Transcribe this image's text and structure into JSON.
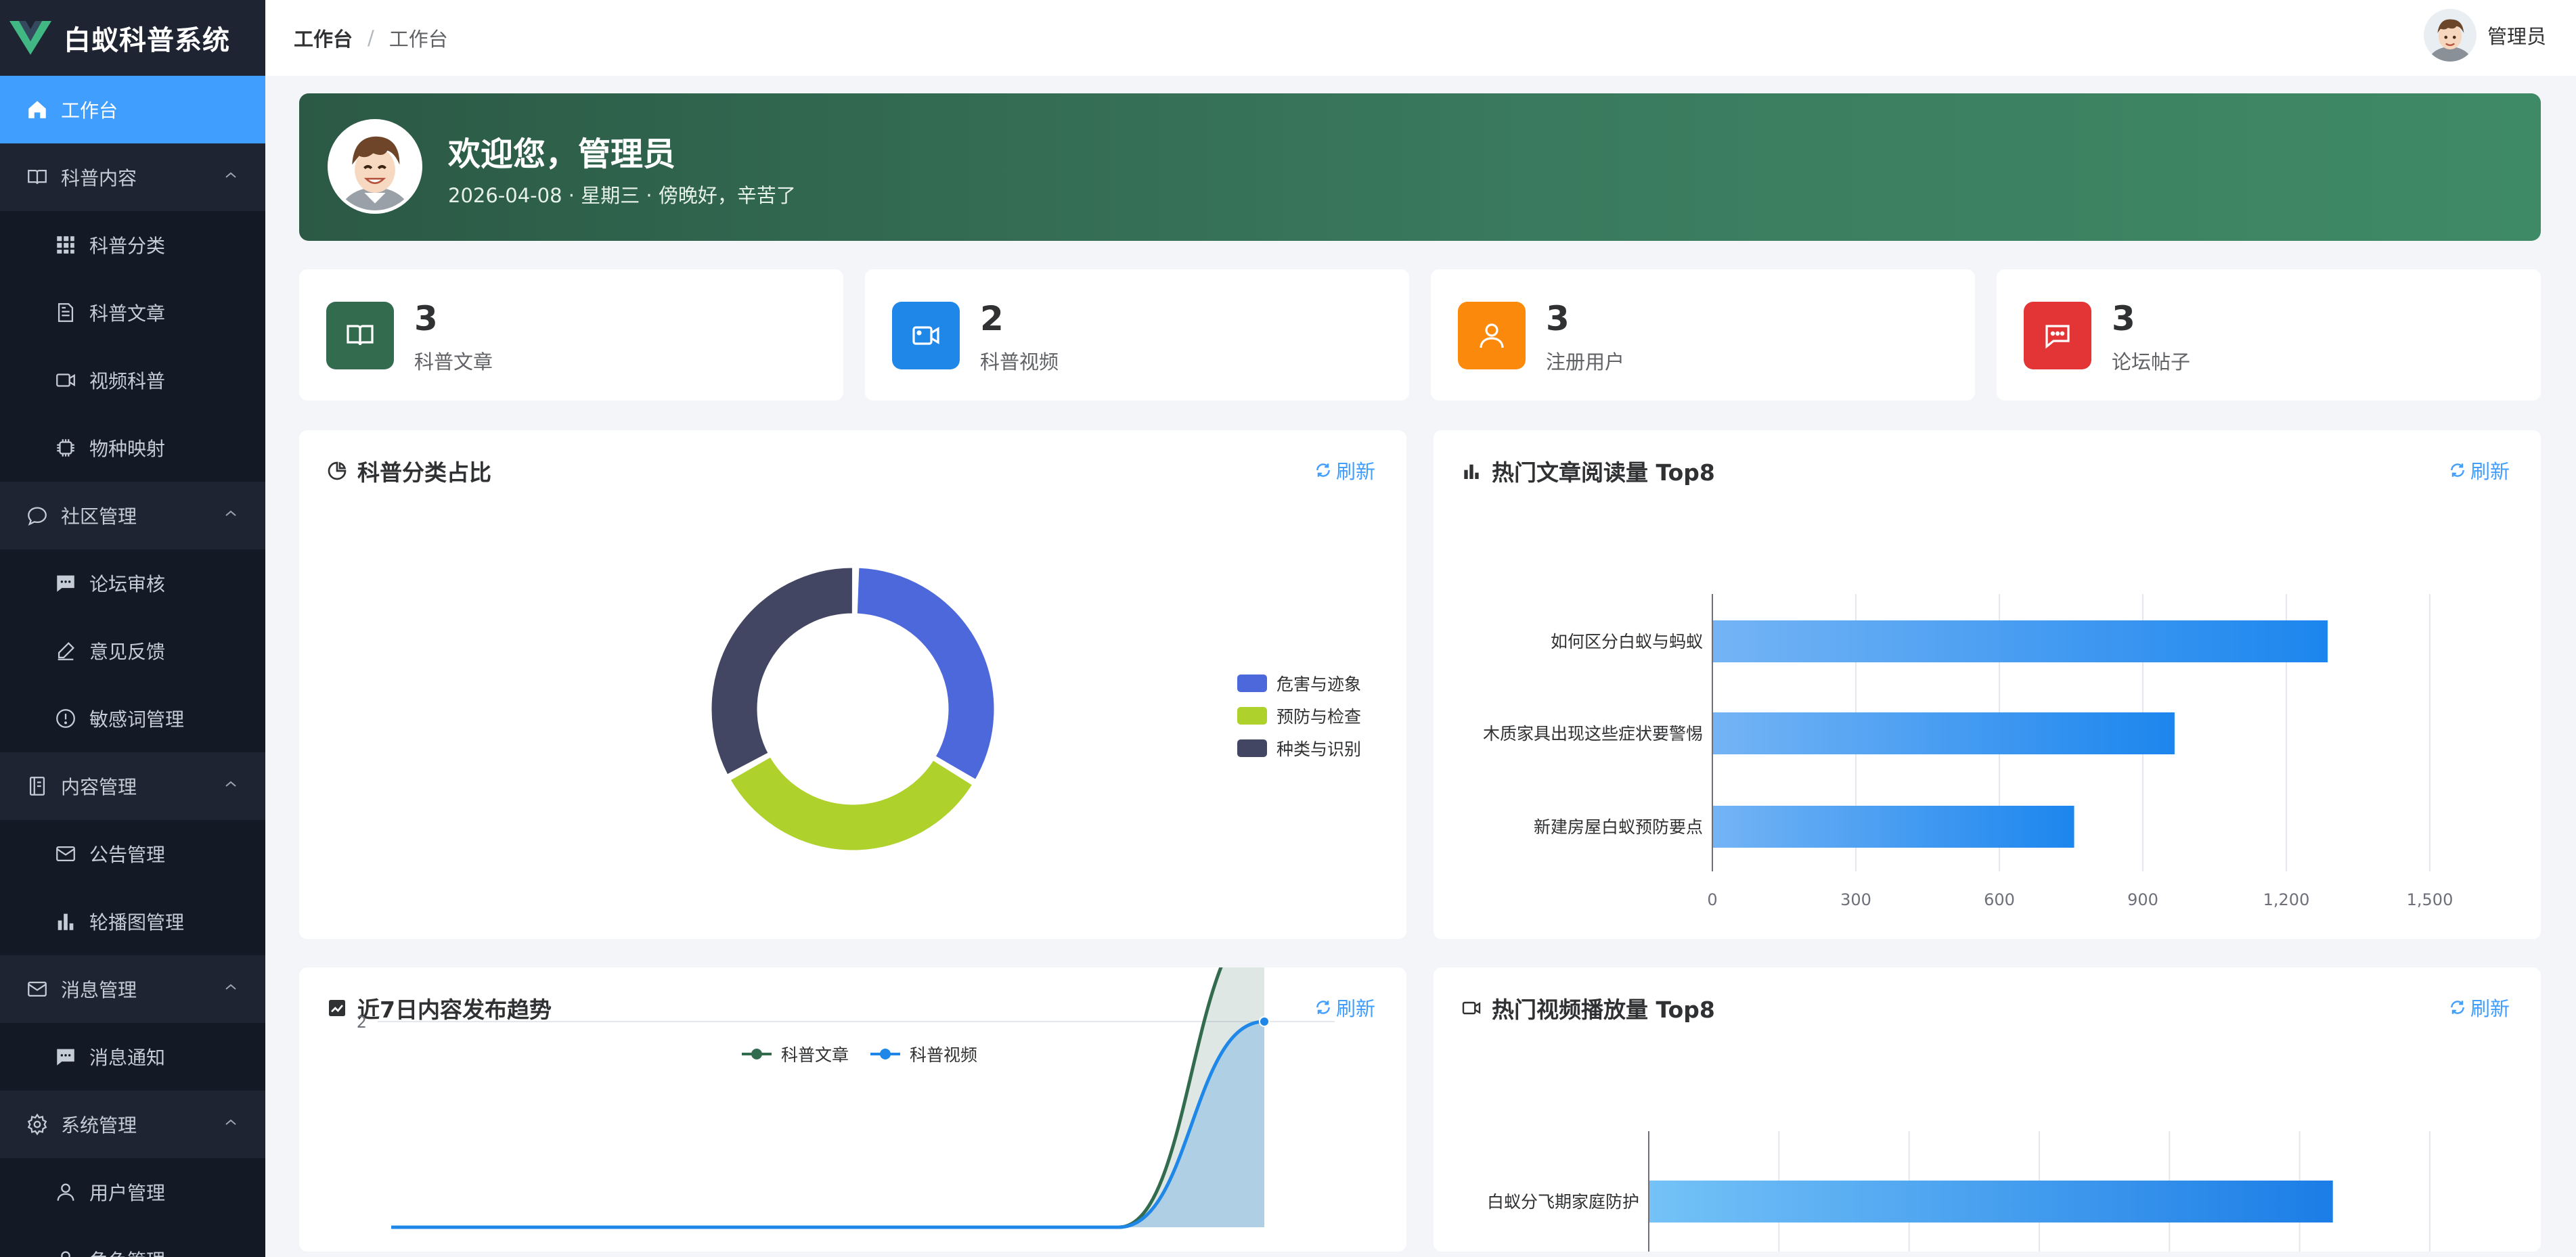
{
  "app": {
    "title": "白蚁科普系统"
  },
  "sidebar": {
    "items": [
      {
        "label": "工作台",
        "icon": "home-icon",
        "level": "parent",
        "active": true
      },
      {
        "label": "科普内容",
        "icon": "book-icon",
        "level": "parent",
        "expanded": true
      },
      {
        "label": "科普分类",
        "icon": "grid-icon",
        "level": "child"
      },
      {
        "label": "科普文章",
        "icon": "document-icon",
        "level": "child"
      },
      {
        "label": "视频科普",
        "icon": "video-icon",
        "level": "child"
      },
      {
        "label": "物种映射",
        "icon": "chip-icon",
        "level": "child"
      },
      {
        "label": "社区管理",
        "icon": "chat-icon",
        "level": "parent",
        "expanded": true
      },
      {
        "label": "论坛审核",
        "icon": "message-icon",
        "level": "child"
      },
      {
        "label": "意见反馈",
        "icon": "edit-icon",
        "level": "child"
      },
      {
        "label": "敏感词管理",
        "icon": "warning-icon",
        "level": "child"
      },
      {
        "label": "内容管理",
        "icon": "notebook-icon",
        "level": "parent",
        "expanded": true
      },
      {
        "label": "公告管理",
        "icon": "mail-icon",
        "level": "child"
      },
      {
        "label": "轮播图管理",
        "icon": "bar-chart-icon",
        "level": "child"
      },
      {
        "label": "消息管理",
        "icon": "mail-icon",
        "level": "parent",
        "expanded": true
      },
      {
        "label": "消息通知",
        "icon": "message-icon",
        "level": "child"
      },
      {
        "label": "系统管理",
        "icon": "gear-icon",
        "level": "parent",
        "expanded": true
      },
      {
        "label": "用户管理",
        "icon": "user-icon",
        "level": "child"
      },
      {
        "label": "角色管理",
        "icon": "user-icon",
        "level": "child"
      }
    ]
  },
  "header": {
    "breadcrumb": [
      "工作台",
      "工作台"
    ],
    "separator": "/",
    "user_name": "管理员"
  },
  "banner": {
    "title": "欢迎您，管理员",
    "subtitle": "2026-04-08 · 星期三 · 傍晚好，辛苦了"
  },
  "stats": [
    {
      "value": "3",
      "label": "科普文章",
      "color": "#336b4f",
      "icon": "book-icon"
    },
    {
      "value": "2",
      "label": "科普视频",
      "color": "#1f87e8",
      "icon": "video-icon"
    },
    {
      "value": "3",
      "label": "注册用户",
      "color": "#fb8a0c",
      "icon": "user-icon"
    },
    {
      "value": "3",
      "label": "论坛帖子",
      "color": "#e33535",
      "icon": "chat-icon"
    }
  ],
  "cards": {
    "refresh_label": "刷新",
    "category_pie": {
      "title": "科普分类占比"
    },
    "article_top": {
      "title": "热门文章阅读量 Top8"
    },
    "trend": {
      "title": "近7日内容发布趋势"
    },
    "video_top": {
      "title": "热门视频播放量 Top8"
    }
  },
  "colors": {
    "accent": "#409eff",
    "sidebar_bg": "#1e2431",
    "sidebar_child_bg": "#131925",
    "banner_start": "#2b5945",
    "banner_end": "#3f8a66"
  },
  "chart_data": [
    {
      "type": "pie",
      "variant": "donut",
      "title": "科普分类占比",
      "categories": [
        "危害与迹象",
        "预防与检查",
        "种类与识别"
      ],
      "values": [
        1,
        1,
        1
      ],
      "colors": [
        "#4d68db",
        "#aed12b",
        "#434663"
      ],
      "legend": "right"
    },
    {
      "type": "bar",
      "orientation": "horizontal",
      "title": "热门文章阅读量 Top8",
      "categories": [
        "如何区分白蚁与蚂蚁",
        "木质家具出现这些症状要警惕",
        "新建房屋白蚁预防要点"
      ],
      "values": [
        1285,
        965,
        755
      ],
      "xlim": [
        0,
        1500
      ],
      "xticks": [
        0,
        300,
        600,
        900,
        1200,
        1500
      ],
      "xtick_labels": [
        "0",
        "300",
        "600",
        "900",
        "1,200",
        "1,500"
      ],
      "grid": true
    },
    {
      "type": "line",
      "title": "近7日内容发布趋势",
      "series": [
        {
          "name": "科普文章",
          "values": [
            0,
            0,
            0,
            0,
            0,
            0,
            3
          ],
          "color": "#336b4f"
        },
        {
          "name": "科普视频",
          "values": [
            0,
            0,
            0,
            0,
            0,
            0,
            2
          ],
          "color": "#1f87e8"
        }
      ],
      "ylim": [
        0,
        3
      ],
      "yticks": [
        2,
        3
      ],
      "legend": "top"
    },
    {
      "type": "bar",
      "orientation": "horizontal",
      "title": "热门视频播放量 Top8",
      "categories": [
        "白蚁分飞期家庭防护"
      ],
      "values": [
        1050
      ],
      "xlim": [
        0,
        1200
      ],
      "grid": true
    }
  ]
}
